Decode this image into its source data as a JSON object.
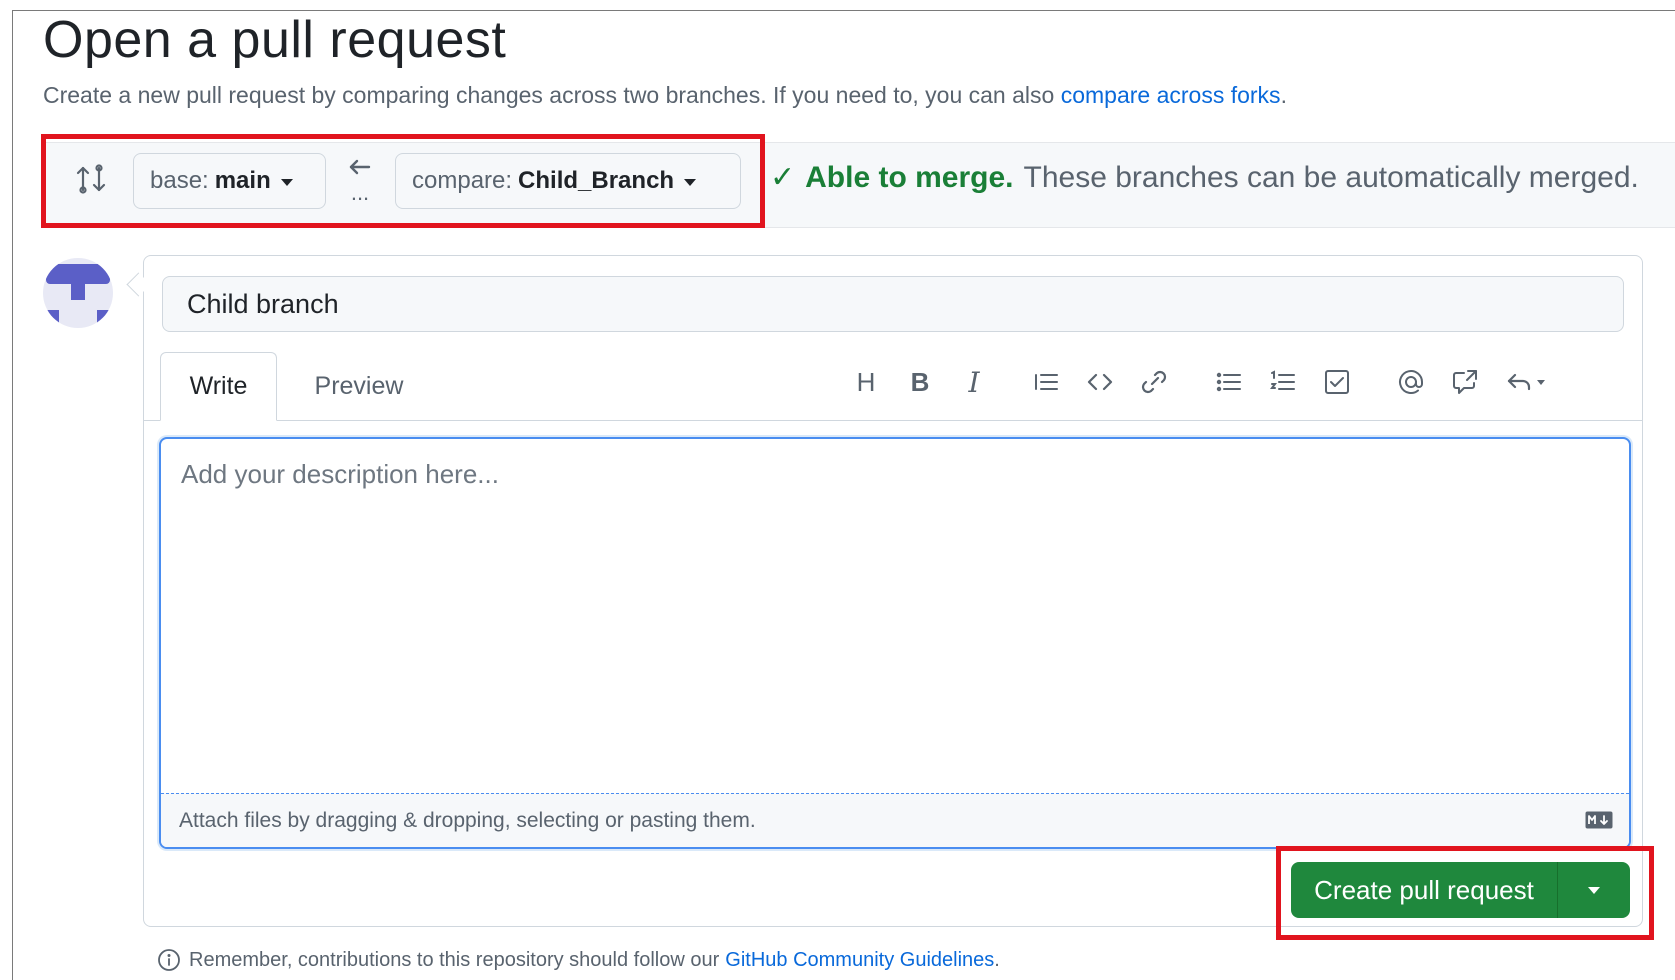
{
  "header": {
    "title": "Open a pull request",
    "subtitle": "Create a new pull request by comparing changes across two branches. If you need to, you can also",
    "subtitle_link": "compare across forks",
    "subtitle_end": "."
  },
  "range": {
    "base_label": "base:",
    "base_value": "main",
    "compare_label": "compare:",
    "compare_value": "Child_Branch",
    "arrow_dots": "...",
    "merge_status": "Able to merge.",
    "merge_detail": "These branches can be automatically merged.",
    "status_color": "#1a7f37"
  },
  "composer": {
    "title_value": "Child branch",
    "tabs": [
      {
        "label": "Write"
      },
      {
        "label": "Preview"
      }
    ],
    "toolbar": {
      "heading": "H",
      "bold": "B",
      "italic": "I",
      "icons": [
        "quote-icon",
        "code-icon",
        "link-icon",
        "unordered-list-icon",
        "ordered-list-icon",
        "task-list-icon",
        "mention-icon",
        "cross-reference-icon",
        "reply-icon"
      ]
    },
    "description_placeholder": "Add your description here...",
    "attach_text": "Attach files by dragging & dropping, selecting or pasting them.",
    "create_label": "Create pull request",
    "button_color": "#1f883d"
  },
  "footer": {
    "note": "Remember, contributions to this repository should follow our",
    "note_link": "GitHub Community Guidelines",
    "note_end": "."
  },
  "highlight_color": "#e1141e"
}
